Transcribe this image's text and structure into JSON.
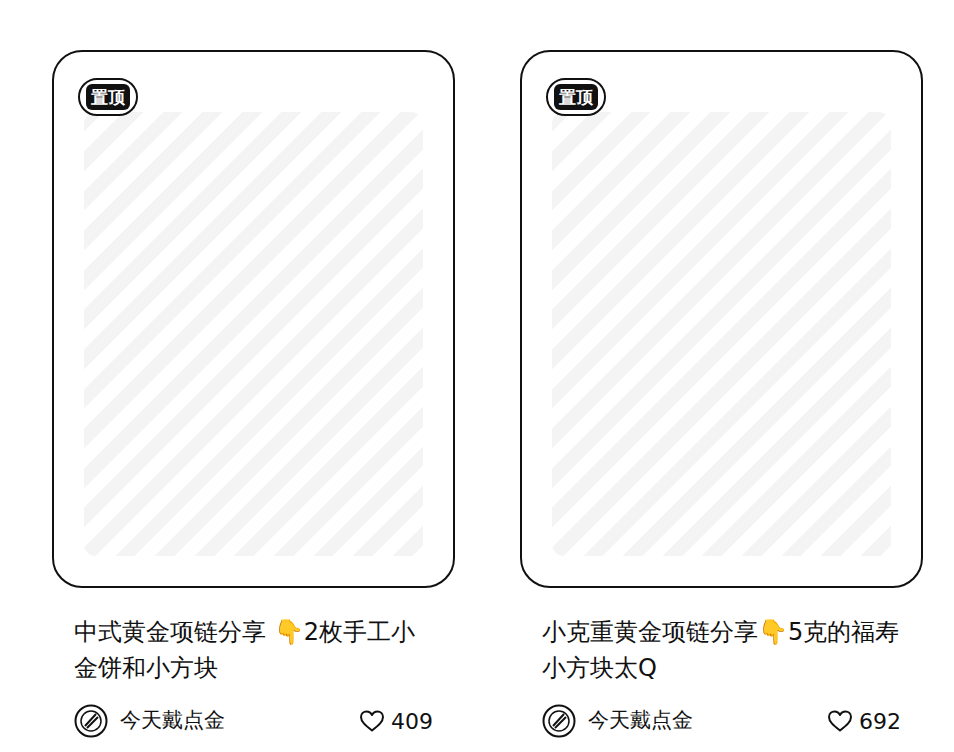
{
  "posts": [
    {
      "pinned": true,
      "badge": "置顶",
      "title": "中式黄金项链分享 👇2枚手工小金饼和小方块",
      "author": "今天戴点金",
      "likes": "409"
    },
    {
      "pinned": true,
      "badge": "置顶",
      "title": "小克重黄金项链分享👇5克的福寿小方块太Q",
      "author": "今天戴点金",
      "likes": "692"
    }
  ]
}
